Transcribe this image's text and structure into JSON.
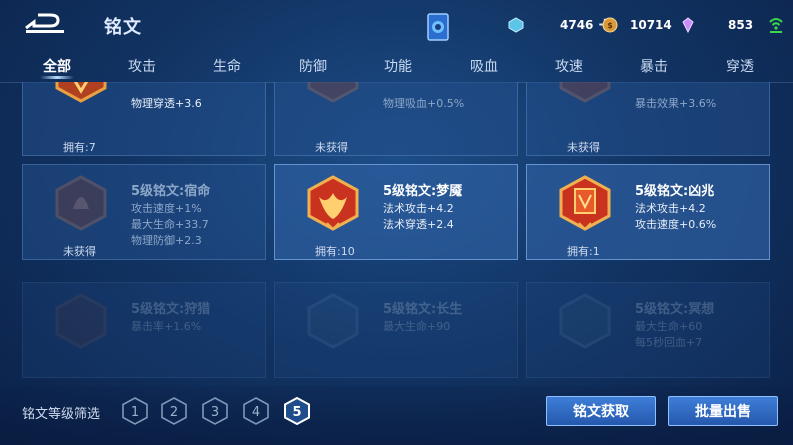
{
  "header": {
    "title": "铭文",
    "diamonds": "4746",
    "coins": "10714",
    "gems": "853"
  },
  "tabs": [
    "全部",
    "攻击",
    "生命",
    "防御",
    "功能",
    "吸血",
    "攻速",
    "暴击",
    "穿透"
  ],
  "cards_top": [
    {
      "attr": "物理穿透+3.6",
      "owned": "拥有:7"
    },
    {
      "attr": "物理吸血+0.5%",
      "owned": "未获得"
    },
    {
      "attr": "暴击效果+3.6%",
      "owned": "未获得"
    }
  ],
  "cards_mid": [
    {
      "name": "5级铭文:宿命",
      "attr1": "攻击速度+1%",
      "attr2": "最大生命+33.7",
      "attr3": "物理防御+2.3",
      "owned": "未获得"
    },
    {
      "name": "5级铭文:梦魇",
      "attr1": "法术攻击+4.2",
      "attr2": "法术穿透+2.4",
      "owned": "拥有:10"
    },
    {
      "name": "5级铭文:凶兆",
      "attr1": "法术攻击+4.2",
      "attr2": "攻击速度+0.6%",
      "owned": "拥有:1"
    }
  ],
  "cards_bot": [
    {
      "name": "5级铭文:狩猎",
      "attr1": "暴击率+1.6%"
    },
    {
      "name": "5级铭文:长生",
      "attr1": "最大生命+90"
    },
    {
      "name": "5级铭文:冥想",
      "attr1": "最大生命+60",
      "attr2": "每5秒回血+7"
    }
  ],
  "filter": {
    "label": "铭文等级筛选",
    "levels": [
      "1",
      "2",
      "3",
      "4",
      "5"
    ]
  },
  "buttons": {
    "obtain": "铭文获取",
    "sell": "批量出售"
  },
  "colors": {
    "accent": "#2f6cc8",
    "gold_emblem": "#e0a040",
    "red_emblem": "#c8321e"
  },
  "icons": {
    "back": "back-arrow-icon",
    "diamond": "diamond-icon",
    "coin": "coin-icon",
    "gem": "gem-icon",
    "signal": "wifi-signal-icon"
  }
}
